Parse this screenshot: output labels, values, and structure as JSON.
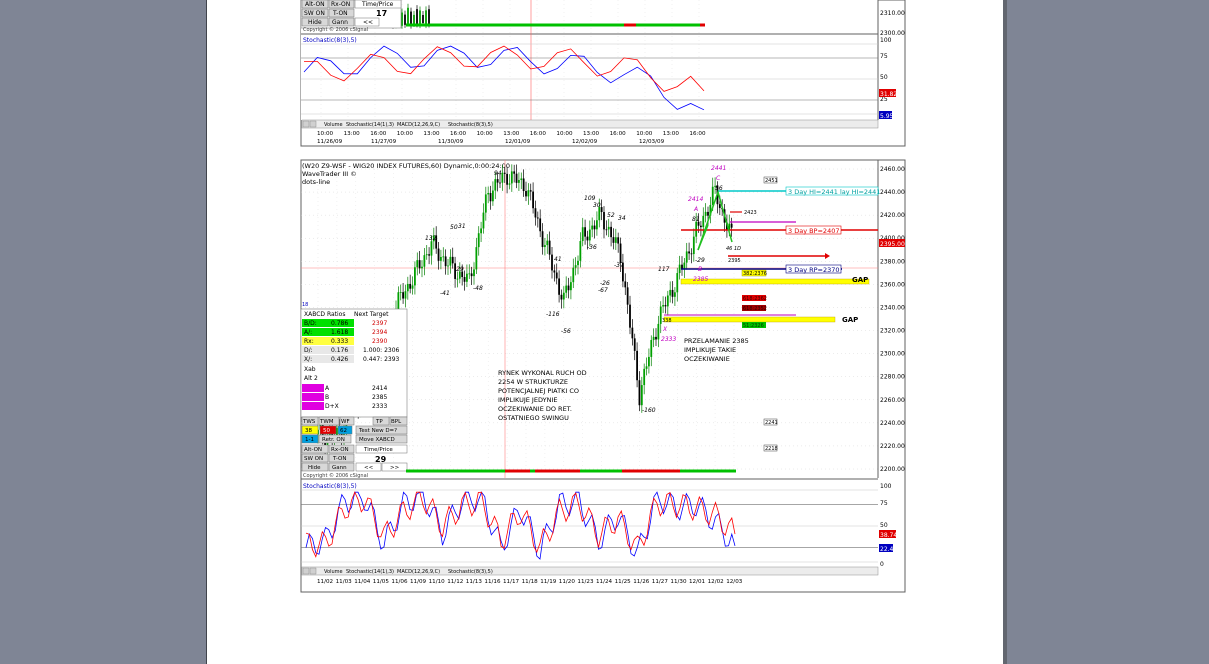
{
  "colors": {
    "page_bg": "#7f8595",
    "paper": "#ffffff",
    "price_up": "#008000",
    "price_down": "#000000",
    "stoch_k": "#0000ff",
    "stoch_d": "#ff0000",
    "cyan_line": "#00c0c0",
    "yellow_zone": "#ffff00",
    "red_line": "#ff0000"
  },
  "top_chart": {
    "axis_labels": [
      "2310.00",
      "2300.00"
    ],
    "stoch_title": "Stochastic(8(3),5)",
    "stoch_axis": [
      "100",
      "75",
      "50",
      "25",
      "0"
    ],
    "stoch_values": [
      "31.82",
      "5.95"
    ],
    "tabs": [
      "Volume",
      "Stochastic(14(1),3)",
      "MACD(12,26,9,C)",
      "Stochastic(8(3),5)"
    ],
    "time_ticks": [
      "10:00",
      "13:00",
      "16:00",
      "10:00",
      "13:00",
      "16:00",
      "10:00",
      "13:00",
      "16:00",
      "10:00",
      "13:00",
      "16:00",
      "10:00",
      "13:00",
      "16:00"
    ],
    "date_ticks": [
      "11/26/09",
      "11/27/09",
      "11/30/09",
      "12/01/09",
      "12/02/09",
      "12/03/09"
    ],
    "panel_rows": [
      {
        "c1": "Alt-ON",
        "c2": "Rx-ON",
        "c3": "Time/Price"
      },
      {
        "c1": "SW ON",
        "c2": "T-ON",
        "c3": "17"
      },
      {
        "c1": "Hide",
        "c2": "Gann",
        "c3": "<<"
      }
    ],
    "copyright": "Copyright © 2006 cSignal"
  },
  "main_chart": {
    "title": "(W20 Z9-WSF - WIG20 INDEX FUTURES,60) Dynamic,0:00:24:00",
    "subtitle1": "WaveTrader III ©",
    "subtitle2": "dots-line",
    "price_axis": [
      "2460.00",
      "2440.00",
      "2420.00",
      "2400.00",
      "2380.00",
      "2360.00",
      "2340.00",
      "2320.00",
      "2300.00",
      "2280.00",
      "2260.00",
      "2240.00",
      "2220.00",
      "2200.00"
    ],
    "last_price": "2395.00",
    "wave_labels": [
      {
        "text": "94",
        "color": "#2020c0"
      },
      {
        "text": "132",
        "color": "#2020c0"
      },
      {
        "text": "50",
        "color": "#2020c0"
      },
      {
        "text": "31",
        "color": "#2020c0"
      },
      {
        "text": "-29",
        "color": "#2020c0"
      },
      {
        "text": "-41",
        "color": "#2020c0"
      },
      {
        "text": "-48",
        "color": "#2020c0"
      },
      {
        "text": "109",
        "color": "#2020c0"
      },
      {
        "text": "30",
        "color": "#2020c0"
      },
      {
        "text": "52",
        "color": "#2020c0"
      },
      {
        "text": "34",
        "color": "#2020c0"
      },
      {
        "text": "-36",
        "color": "#2020c0"
      },
      {
        "text": "41",
        "color": "#2020c0"
      },
      {
        "text": "-37",
        "color": "#2020c0"
      },
      {
        "text": "-26",
        "color": "#2020c0"
      },
      {
        "text": "-67",
        "color": "#2020c0"
      },
      {
        "text": "-116",
        "color": "#2020c0"
      },
      {
        "text": "-56",
        "color": "#2020c0"
      },
      {
        "text": "117",
        "color": "#2020c0"
      },
      {
        "text": "-160",
        "color": "#2020c0"
      },
      {
        "text": "81",
        "color": "#2020c0"
      },
      {
        "text": "56",
        "color": "#2020c0"
      },
      {
        "text": "-29",
        "color": "#2020c0"
      },
      {
        "text": "2441",
        "color": "#c000c0"
      },
      {
        "text": "C",
        "color": "#c000c0"
      },
      {
        "text": "2414",
        "color": "#c000c0"
      },
      {
        "text": "A",
        "color": "#c000c0"
      },
      {
        "text": "B",
        "color": "#c000c0"
      },
      {
        "text": "2385",
        "color": "#c000c0"
      },
      {
        "text": "X",
        "color": "#c000c0"
      },
      {
        "text": "2333",
        "color": "#c000c0"
      }
    ],
    "levels": {
      "hi": "3 Day HI=2441 lay HI=2441",
      "bp": "3 Day BP=2407",
      "rp": "3 Day RP=2370",
      "gap": "GAP",
      "gap2": "GAP",
      "l2451": "2451",
      "l2423": "2423",
      "l2395": "2395",
      "l2241": "2241",
      "l2218": "2218",
      "ratio1": "382:2376",
      "ratio2": "618:2362",
      "ratio3": "618:2352",
      "ratio4": "51:2326",
      "l2338": "338"
    },
    "marker_46": "46 1D",
    "notes": {
      "note1": [
        "RYNEK WYKONAL RUCH OD",
        "2254 W STRUKTURZE",
        "POTENCJALNEJ PIATKI CO",
        "IMPLIKUJE JEDYNIE",
        "OCZEKIWANIE DO RET.",
        "OSTATNIEGO SWINGU"
      ],
      "note2": [
        "PRZELAMANIE 2385",
        "IMPLIKUJE TAKIE",
        "OCZEKIWANIE"
      ]
    },
    "xabcd": {
      "header": [
        "XABCD Ratios",
        "Next Target"
      ],
      "rows": [
        [
          "B/D:",
          "0.786",
          "2397"
        ],
        [
          "A/:",
          "1.618",
          "2394"
        ],
        [
          "Rx:",
          "0.333",
          "2390"
        ],
        [
          "D/:",
          "0.176",
          "1.000: 2306"
        ],
        [
          "X/:",
          "0.426",
          "0.447: 2393"
        ]
      ],
      "mid_rows": [
        "Xab",
        "Alt 2"
      ],
      "targets": [
        {
          "label": "A",
          "value": "2414"
        },
        {
          "label": "B",
          "value": "2385"
        },
        {
          "label": "D+X",
          "value": "2333"
        }
      ],
      "controls": [
        "TWS",
        "TWM",
        "WF",
        "TP",
        "BPL"
      ],
      "retr_row": {
        "a": "38",
        "b": "50",
        "c": "62",
        "d": "Test New D=?"
      },
      "move_row": {
        "a": "1-1",
        "b": "Retr. ON",
        "c": "Move XABCD"
      },
      "rows2": [
        {
          "c1": "Alt-ON",
          "c2": "Rx-ON",
          "c3": "Time/Price"
        },
        {
          "c1": "SW ON",
          "c2": "T-ON",
          "c3": "29"
        },
        {
          "c1": "Hide",
          "c2": "Gann",
          "c3": "<<",
          "c4": ">>"
        }
      ],
      "copyright": "Copyright © 2006 cSignal",
      "side_mark": "18"
    },
    "stoch_title": "Stochastic(8(3),5)",
    "stoch_axis": [
      "100",
      "75",
      "50",
      "25",
      "0"
    ],
    "stoch_values": [
      "38.74",
      "22.4"
    ],
    "tabs": [
      "Volume",
      "Stochastic(14(1),3)",
      "MACD(12,26,9,C)",
      "Stochastic(8(3),5)"
    ],
    "date_ticks": [
      "11/02",
      "11/03",
      "11/04",
      "11/05",
      "11/06",
      "11/09",
      "11/10",
      "11/12",
      "11/13",
      "11/16",
      "11/17",
      "11/18",
      "11/19",
      "11/20",
      "11/23",
      "11/24",
      "11/25",
      "11/26",
      "11/27",
      "11/30",
      "12/01",
      "12/02",
      "12/03"
    ]
  },
  "chart_data": [
    {
      "type": "line",
      "title": "",
      "xlabel": "",
      "ylabel": "",
      "x": [
        "11/26/09",
        "11/27/09",
        "11/30/09",
        "12/01/09",
        "12/02/09",
        "12/03/09"
      ],
      "series": [
        {
          "name": "Stochastic(8(3),5)",
          "values": [
            60,
            80,
            85,
            75,
            60,
            5.95
          ]
        }
      ],
      "ylim": [
        0,
        100
      ]
    },
    {
      "type": "line",
      "title": "(W20 Z9-WSF - WIG20 INDEX FUTURES,60) Dynamic,0:00:24:00",
      "xlabel": "",
      "ylabel": "",
      "x": [
        "11/02",
        "11/03",
        "11/04",
        "11/05",
        "11/06",
        "11/09",
        "11/10",
        "11/12",
        "11/13",
        "11/16",
        "11/17",
        "11/18",
        "11/19",
        "11/20",
        "11/23",
        "11/24",
        "11/25",
        "11/26",
        "11/27",
        "11/30",
        "12/01",
        "12/02",
        "12/03"
      ],
      "series": [
        {
          "name": "",
          "values": [
            2230,
            2228,
            2255,
            2285,
            2338,
            2365,
            2395,
            2375,
            2362,
            2440,
            2455,
            2445,
            2395,
            2345,
            2400,
            2420,
            2385,
            2265,
            2330,
            2365,
            2405,
            2440,
            2395
          ]
        }
      ],
      "ylim": [
        2200,
        2465
      ]
    },
    {
      "type": "line",
      "title": "Stochastic(8(3),5)",
      "xlabel": "",
      "ylabel": "",
      "x": [
        "11/02",
        "11/03",
        "11/04",
        "11/05",
        "11/06",
        "11/09",
        "11/10",
        "11/12",
        "11/13",
        "11/16",
        "11/17",
        "11/18",
        "11/19",
        "11/20",
        "11/23",
        "11/24",
        "11/25",
        "11/26",
        "11/27",
        "11/30",
        "12/01",
        "12/02",
        "12/03"
      ],
      "series": [
        {
          "name": "%K",
          "values": [
            20,
            30,
            85,
            90,
            25,
            80,
            95,
            40,
            85,
            90,
            20,
            75,
            15,
            80,
            85,
            30,
            65,
            10,
            90,
            75,
            80,
            55,
            22.4
          ]
        },
        {
          "name": "%D",
          "values": [
            25,
            25,
            75,
            88,
            35,
            70,
            90,
            50,
            78,
            85,
            30,
            70,
            20,
            70,
            82,
            38,
            60,
            18,
            82,
            80,
            75,
            65,
            38.74
          ]
        }
      ],
      "ylim": [
        0,
        100
      ]
    }
  ]
}
